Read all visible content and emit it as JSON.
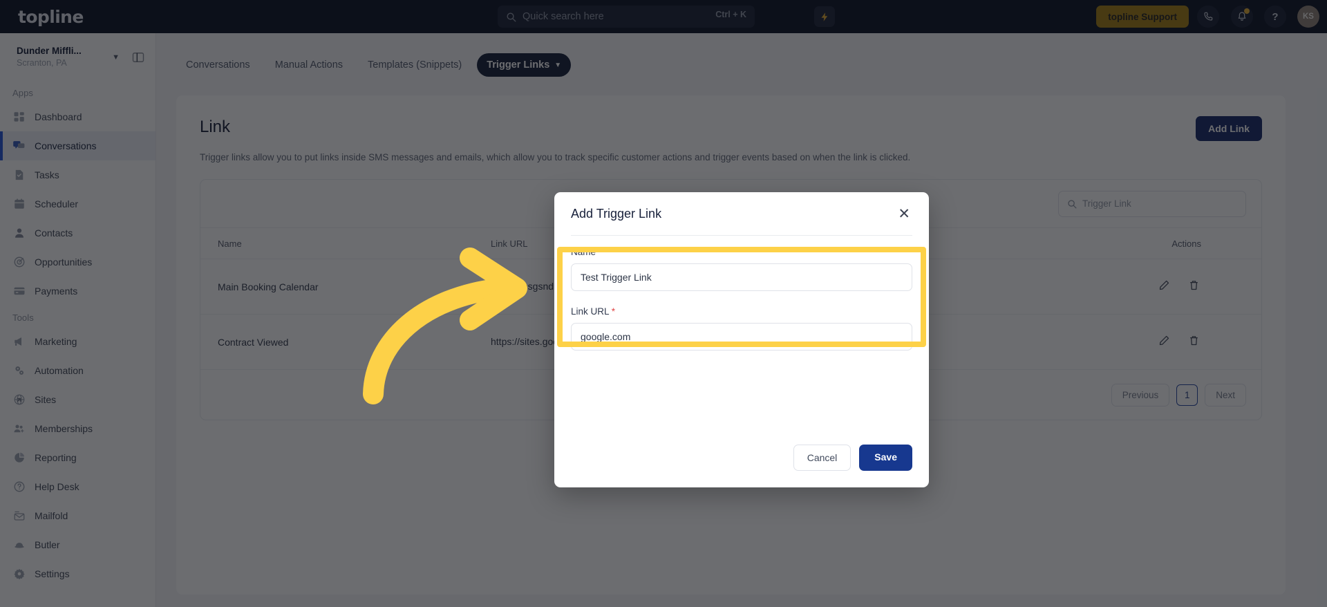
{
  "topbar": {
    "brand": "topline",
    "search_placeholder": "Quick search here",
    "search_shortcut": "Ctrl + K",
    "bolt_label": "⚡",
    "support_label": "topline Support",
    "help_label": "?",
    "avatar_initials": "KS"
  },
  "sidebar": {
    "location_name": "Dunder Miffli...",
    "location_sub": "Scranton, PA",
    "sections": [
      {
        "label": "Apps",
        "items": [
          {
            "label": "Dashboard",
            "icon": "dashboard-icon",
            "active": false
          },
          {
            "label": "Conversations",
            "icon": "conversations-icon",
            "active": true
          },
          {
            "label": "Tasks",
            "icon": "tasks-icon",
            "active": false
          },
          {
            "label": "Scheduler",
            "icon": "calendar-icon",
            "active": false
          },
          {
            "label": "Contacts",
            "icon": "contacts-icon",
            "active": false
          },
          {
            "label": "Opportunities",
            "icon": "target-icon",
            "active": false
          },
          {
            "label": "Payments",
            "icon": "card-icon",
            "active": false
          }
        ]
      },
      {
        "label": "Tools",
        "items": [
          {
            "label": "Marketing",
            "icon": "megaphone-icon",
            "active": false
          },
          {
            "label": "Automation",
            "icon": "gears-icon",
            "active": false
          },
          {
            "label": "Sites",
            "icon": "globe-icon",
            "active": false
          },
          {
            "label": "Memberships",
            "icon": "members-icon",
            "active": false
          },
          {
            "label": "Reporting",
            "icon": "pie-chart-icon",
            "active": false
          },
          {
            "label": "Help Desk",
            "icon": "help-circle-icon",
            "active": false
          },
          {
            "label": "Mailfold",
            "icon": "mail-icon",
            "active": false
          },
          {
            "label": "Butler",
            "icon": "butler-icon",
            "active": false
          },
          {
            "label": "Settings",
            "icon": "gear-icon",
            "active": false
          }
        ]
      }
    ]
  },
  "tabs": [
    {
      "label": "Conversations",
      "active": false
    },
    {
      "label": "Manual Actions",
      "active": false
    },
    {
      "label": "Templates (Snippets)",
      "active": false
    },
    {
      "label": "Trigger Links",
      "active": true
    }
  ],
  "page": {
    "title": "Link",
    "description": "Trigger links allow you to put links inside SMS messages and emails, which allow you to track specific customer actions and trigger events based on when the link is clicked.",
    "add_link_label": "Add Link",
    "search_placeholder": "Trigger Link"
  },
  "table": {
    "columns": [
      "Name",
      "Link URL",
      "Actions"
    ],
    "rows": [
      {
        "name": "Main Booking Calendar",
        "url": "https://msgsndr.com/widget/booking/ttckzct"
      },
      {
        "name": "Contract Viewed",
        "url": "https://sites.google.com/view/contract"
      }
    ]
  },
  "pagination": {
    "previous": "Previous",
    "page": "1",
    "next": "Next"
  },
  "modal": {
    "title": "Add Trigger Link",
    "close_label": "✕",
    "name_label": "Name",
    "name_required": "*",
    "name_value": "Test Trigger Link",
    "url_label": "Link URL",
    "url_required": "*",
    "url_value": "google.com",
    "cancel_label": "Cancel",
    "save_label": "Save"
  },
  "colors": {
    "topbar_bg": "#050b1f",
    "accent_blue": "#17388f",
    "highlight_yellow": "#fdd148",
    "support_gold": "#a1790d",
    "required_red": "#e04545"
  }
}
